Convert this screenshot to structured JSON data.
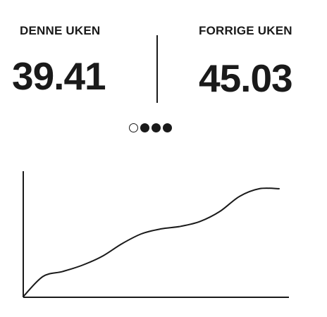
{
  "stats": {
    "this_week": {
      "label": "DENNE UKEN",
      "value": "39.41"
    },
    "last_week": {
      "label": "FORRIGE UKEN",
      "value": "45.03"
    }
  },
  "pager": {
    "dots": [
      {
        "state": "inactive"
      },
      {
        "state": "active"
      },
      {
        "state": "active"
      },
      {
        "state": "active"
      }
    ]
  },
  "chart_data": {
    "type": "line",
    "title": "",
    "xlabel": "",
    "ylabel": "",
    "series": [
      {
        "values": [
          0,
          16,
          20,
          25,
          32,
          42,
          50,
          54,
          56,
          60,
          68,
          80,
          86,
          86
        ]
      }
    ],
    "ylim": [
      0,
      100
    ],
    "grid": false,
    "colors": {
      "line": "#1a1a1a",
      "axes": "#1a1a1a"
    }
  }
}
